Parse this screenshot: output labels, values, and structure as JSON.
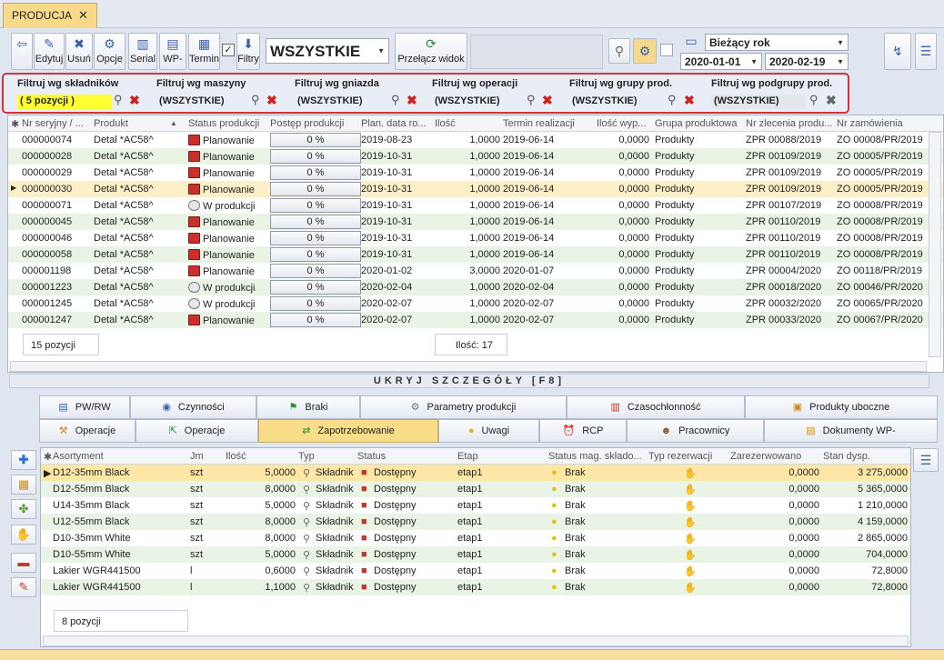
{
  "tab": {
    "title": "PRODUCJA",
    "close": "✕"
  },
  "toolbar": {
    "buttons": [
      {
        "label": "",
        "icon": "⇦"
      },
      {
        "label": "Edytuj",
        "icon": "✎"
      },
      {
        "label": "Usuń",
        "icon": "✖"
      },
      {
        "label": "Opcje",
        "icon": "⚙"
      },
      {
        "label": "Serial",
        "icon": "▥"
      },
      {
        "label": "WP-",
        "icon": "▤"
      },
      {
        "label": "Termin",
        "icon": "▦"
      },
      {
        "label": "Filtry",
        "icon": "⬇"
      },
      {
        "label": "Przełącz widok",
        "icon": "⟳"
      }
    ],
    "filter_select": "WSZYSTKIE",
    "period": "Bieżący rok",
    "date_from": "2020-01-01",
    "date_to": "2020-02-19"
  },
  "filters": [
    {
      "title": "Filtruj wg składników",
      "value": "( 5 pozycji )"
    },
    {
      "title": "Filtruj wg maszyny",
      "value": "(WSZYSTKIE)"
    },
    {
      "title": "Filtruj wg gniazda",
      "value": "(WSZYSTKIE)"
    },
    {
      "title": "Filtruj wg operacji",
      "value": "(WSZYSTKIE)"
    },
    {
      "title": "Filtruj wg grupy prod.",
      "value": "(WSZYSTKIE)"
    },
    {
      "title": "Filtruj wg podgrupy prod.",
      "value": "(WSZYSTKIE)"
    }
  ],
  "main_grid": {
    "columns": [
      "Nr seryjny / ...",
      "Produkt",
      "Status produkcji",
      "Postęp produkcji",
      "Plan. data ro...",
      "Ilość",
      "Termin realizacji",
      "Ilość wyp...",
      "Grupa produktowa",
      "Nr zlecenia produ...",
      "Nr zamówienia"
    ],
    "rows": [
      [
        "000000074",
        "Detal *AC58^",
        "Planowanie",
        "0 %",
        "2019-08-23",
        "1,0000",
        "2019-06-14",
        "0,0000",
        "Produkty",
        "ZPR 00088/2019",
        "ZO 00008/PR/2019"
      ],
      [
        "000000028",
        "Detal *AC58^",
        "Planowanie",
        "0 %",
        "2019-10-31",
        "1,0000",
        "2019-06-14",
        "0,0000",
        "Produkty",
        "ZPR 00109/2019",
        "ZO 00005/PR/2019"
      ],
      [
        "000000029",
        "Detal *AC58^",
        "Planowanie",
        "0 %",
        "2019-10-31",
        "1,0000",
        "2019-06-14",
        "0,0000",
        "Produkty",
        "ZPR 00109/2019",
        "ZO 00005/PR/2019"
      ],
      [
        "000000030",
        "Detal *AC58^",
        "Planowanie",
        "0 %",
        "2019-10-31",
        "1,0000",
        "2019-06-14",
        "0,0000",
        "Produkty",
        "ZPR 00109/2019",
        "ZO 00005/PR/2019"
      ],
      [
        "000000071",
        "Detal *AC58^",
        "W produkcji",
        "0 %",
        "2019-10-31",
        "1,0000",
        "2019-06-14",
        "0,0000",
        "Produkty",
        "ZPR 00107/2019",
        "ZO 00008/PR/2019"
      ],
      [
        "000000045",
        "Detal *AC58^",
        "Planowanie",
        "0 %",
        "2019-10-31",
        "1,0000",
        "2019-06-14",
        "0,0000",
        "Produkty",
        "ZPR 00110/2019",
        "ZO 00008/PR/2019"
      ],
      [
        "000000046",
        "Detal *AC58^",
        "Planowanie",
        "0 %",
        "2019-10-31",
        "1,0000",
        "2019-06-14",
        "0,0000",
        "Produkty",
        "ZPR 00110/2019",
        "ZO 00008/PR/2019"
      ],
      [
        "000000058",
        "Detal *AC58^",
        "Planowanie",
        "0 %",
        "2019-10-31",
        "1,0000",
        "2019-06-14",
        "0,0000",
        "Produkty",
        "ZPR 00110/2019",
        "ZO 00008/PR/2019"
      ],
      [
        "000001198",
        "Detal *AC58^",
        "Planowanie",
        "0 %",
        "2020-01-02",
        "3,0000",
        "2020-01-07",
        "0,0000",
        "Produkty",
        "ZPR 00004/2020",
        "ZO 00118/PR/2019"
      ],
      [
        "000001223",
        "Detal *AC58^",
        "W produkcji",
        "0 %",
        "2020-02-04",
        "1,0000",
        "2020-02-04",
        "0,0000",
        "Produkty",
        "ZPR 00018/2020",
        "ZO 00046/PR/2020"
      ],
      [
        "000001245",
        "Detal *AC58^",
        "W produkcji",
        "0 %",
        "2020-02-07",
        "1,0000",
        "2020-02-07",
        "0,0000",
        "Produkty",
        "ZPR 00032/2020",
        "ZO 00065/PR/2020"
      ],
      [
        "000001247",
        "Detal *AC58^",
        "Planowanie",
        "0 %",
        "2020-02-07",
        "1,0000",
        "2020-02-07",
        "0,0000",
        "Produkty",
        "ZPR 00033/2020",
        "ZO 00067/PR/2020"
      ]
    ],
    "footer_count": "15 pozycji",
    "footer_sum": "Ilość:  17"
  },
  "hide_details": "UKRYJ SZCZEGÓŁY [F8]",
  "detail_tabs_row1": [
    "PW/RW",
    "Czynności",
    "Braki",
    "Parametry produkcji",
    "Czasochłonność",
    "Produkty uboczne"
  ],
  "detail_tabs_row2": [
    "Operacje",
    "Operacje",
    "Zapotrzebowanie",
    "Uwagi",
    "RCP",
    "Pracownicy",
    "Dokumenty WP-"
  ],
  "detail_grid": {
    "columns": [
      "Asortyment",
      "Jm",
      "Ilość",
      "Typ",
      "Status",
      "Etap",
      "Status mag. składo...",
      "Typ rezerwacji",
      "Zarezerwowano",
      "Stan dysp."
    ],
    "rows": [
      [
        "D12-35mm Black",
        "szt",
        "5,0000",
        "Składnik",
        "Dostępny",
        "etap1",
        "Brak",
        "0,0000",
        "3 275,0000"
      ],
      [
        "D12-55mm Black",
        "szt",
        "8,0000",
        "Składnik",
        "Dostępny",
        "etap1",
        "Brak",
        "0,0000",
        "5 365,0000"
      ],
      [
        "U14-35mm Black",
        "szt",
        "5,0000",
        "Składnik",
        "Dostępny",
        "etap1",
        "Brak",
        "0,0000",
        "1 210,0000"
      ],
      [
        "U12-55mm Black",
        "szt",
        "8,0000",
        "Składnik",
        "Dostępny",
        "etap1",
        "Brak",
        "0,0000",
        "4 159,0000"
      ],
      [
        "D10-35mm White",
        "szt",
        "8,0000",
        "Składnik",
        "Dostępny",
        "etap1",
        "Brak",
        "0,0000",
        "2 865,0000"
      ],
      [
        "D10-55mm White",
        "szt",
        "5,0000",
        "Składnik",
        "Dostępny",
        "etap1",
        "Brak",
        "0,0000",
        "704,0000"
      ],
      [
        "Lakier WGR441500",
        "l",
        "0,6000",
        "Składnik",
        "Dostępny",
        "etap1",
        "Brak",
        "0,0000",
        "72,8000"
      ],
      [
        "Lakier WGR441500",
        "l",
        "1,1000",
        "Składnik",
        "Dostępny",
        "etap1",
        "Brak",
        "0,0000",
        "72,8000"
      ]
    ],
    "footer_count": "8 pozycji"
  }
}
